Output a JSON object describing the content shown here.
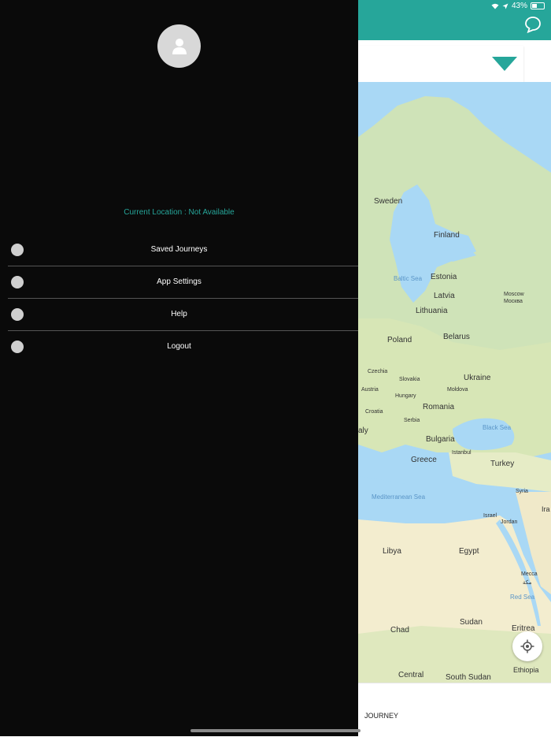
{
  "status": {
    "battery": "43%"
  },
  "drawer": {
    "location_text": "Current Location : Not Available",
    "menu": [
      {
        "label": "Saved Journeys",
        "icon": "person-icon"
      },
      {
        "label": "App Settings",
        "icon": "person-icon"
      },
      {
        "label": "Help",
        "icon": "person-icon"
      },
      {
        "label": "Logout",
        "icon": "person-icon"
      }
    ]
  },
  "map": {
    "labels": {
      "sweden": "Sweden",
      "finland": "Finland",
      "baltic": "Baltic Sea",
      "estonia": "Estonia",
      "latvia": "Latvia",
      "moscow": "Moscow",
      "moscow_ru": "Москва",
      "lithuania": "Lithuania",
      "poland": "Poland",
      "belarus": "Belarus",
      "czechia": "Czechia",
      "slovakia": "Slovakia",
      "ukraine": "Ukraine",
      "moldova": "Moldova",
      "austria": "Austria",
      "hungary": "Hungary",
      "croatia": "Croatia",
      "romania": "Romania",
      "serbia": "Serbia",
      "black_sea": "Black Sea",
      "italy": "aly",
      "bulgaria": "Bulgaria",
      "istanbul": "Istanbul",
      "greece": "Greece",
      "turkey": "Turkey",
      "syria": "Syria",
      "mediterranean": "Mediterranean Sea",
      "iraq": "Ira",
      "israel": "Israel",
      "jordan": "Jordan",
      "libya": "Libya",
      "egypt": "Egypt",
      "mecca": "Mecca",
      "mecca_ar": "مكة",
      "red_sea": "Red Sea",
      "chad": "Chad",
      "sudan": "Sudan",
      "eritrea": "Eritrea",
      "central": "Central",
      "south_sudan": "South Sudan",
      "ethiopia": "Ethiopia"
    }
  },
  "bottom_panel": {
    "journey_label": "JOURNEY"
  }
}
